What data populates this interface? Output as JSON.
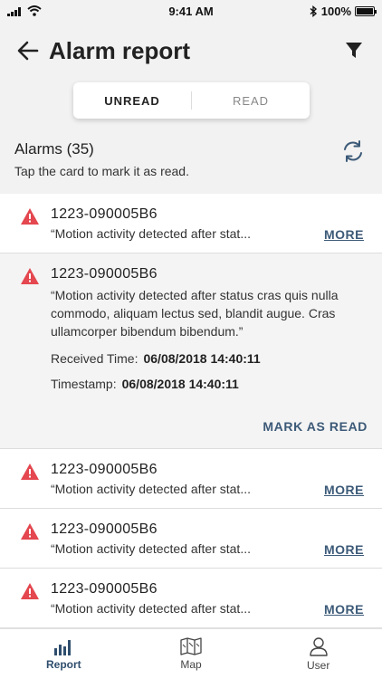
{
  "status_bar": {
    "time": "9:41 AM",
    "battery": "100%",
    "battery_level": 1.0
  },
  "header": {
    "title": "Alarm report"
  },
  "segment": {
    "unread_label": "UNREAD",
    "read_label": "READ",
    "selected": "unread"
  },
  "alarms": {
    "title": "Alarms (35)",
    "subtitle": "Tap the card to mark it as read."
  },
  "cards": [
    {
      "id": "1223-090005B6",
      "message": "“Motion activity detected after stat...",
      "more_label": "MORE"
    },
    {
      "id": "1223-090005B6",
      "message": "“Motion activity detected after status cras quis nulla commodo, aliquam lectus sed, blandit augue. Cras ullamcorper bibendum bibendum.”",
      "received_label": "Received Time:",
      "received_value": "06/08/2018 14:40:11",
      "timestamp_label": "Timestamp:",
      "timestamp_value": "06/08/2018 14:40:11",
      "mark_read_label": "MARK AS READ"
    },
    {
      "id": "1223-090005B6",
      "message": "“Motion activity detected after stat...",
      "more_label": "MORE"
    },
    {
      "id": "1223-090005B6",
      "message": "“Motion activity detected after stat...",
      "more_label": "MORE"
    },
    {
      "id": "1223-090005B6",
      "message": "“Motion activity detected after stat...",
      "more_label": "MORE"
    }
  ],
  "tabbar": {
    "report_label": "Report",
    "map_label": "Map",
    "user_label": "User",
    "active": "report"
  },
  "colors": {
    "accent": "#3c5a78",
    "alert": "#e4474f"
  },
  "icons": {
    "back": "arrow-left-icon",
    "filter": "filter-icon",
    "refresh": "refresh-icon",
    "alert": "warning-triangle-icon"
  }
}
